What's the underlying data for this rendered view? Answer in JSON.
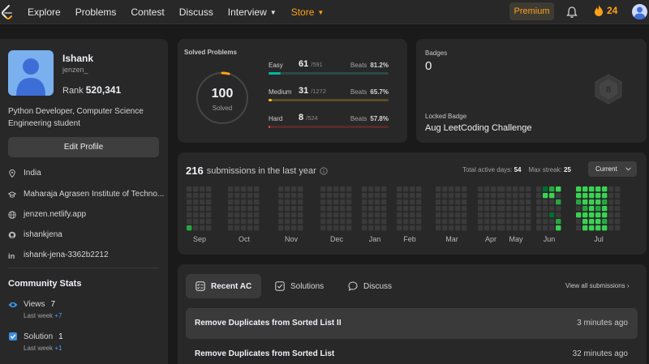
{
  "nav": {
    "items": [
      {
        "label": "Explore"
      },
      {
        "label": "Problems"
      },
      {
        "label": "Contest"
      },
      {
        "label": "Discuss"
      },
      {
        "label": "Interview"
      },
      {
        "label": "Store"
      }
    ],
    "premium_label": "Premium",
    "streak_count": "24",
    "colors": {
      "accent": "#ffa116",
      "bg": "#282828"
    }
  },
  "profile": {
    "name": "Ishank",
    "username": "jenzen_",
    "rank_label": "Rank",
    "rank_value": "520,341",
    "bio": "Python Developer, Computer Science Engineering student",
    "edit_label": "Edit Profile",
    "info": [
      {
        "icon": "location-icon",
        "text": "India"
      },
      {
        "icon": "graduation-cap-icon",
        "text": "Maharaja Agrasen Institute of Techno..."
      },
      {
        "icon": "globe-icon",
        "text": "jenzen.netlify.app"
      },
      {
        "icon": "github-icon",
        "text": "ishankjena"
      },
      {
        "icon": "linkedin-icon",
        "text": "ishank-jena-3362b2212"
      }
    ]
  },
  "community": {
    "title": "Community Stats",
    "views_label": "Views",
    "views_value": "7",
    "views_sub": "Last week",
    "views_delta": "+7",
    "solution_label": "Solution",
    "solution_value": "1",
    "solution_sub": "Last week",
    "solution_delta": "+1"
  },
  "solved": {
    "title": "Solved Problems",
    "total": "100",
    "total_label": "Solved",
    "ring_fraction": 0.042,
    "difficulties": [
      {
        "label": "Easy",
        "count": "61",
        "total": "/591",
        "beats_label": "Beats",
        "beats": "81.2%",
        "color": "#00b8a3",
        "fraction": 0.103
      },
      {
        "label": "Medium",
        "count": "31",
        "total": "/1272",
        "beats_label": "Beats",
        "beats": "65.7%",
        "color": "#ffc01e",
        "fraction": 0.024
      },
      {
        "label": "Hard",
        "count": "8",
        "total": "/524",
        "beats_label": "Beats",
        "beats": "57.8%",
        "color": "#ef4743",
        "fraction": 0.015
      }
    ]
  },
  "badges": {
    "label": "Badges",
    "count": "0",
    "locked_label": "Locked Badge",
    "locked_name": "Aug LeetCoding Challenge"
  },
  "heatmap": {
    "count": "216",
    "title_rest": "submissions in the last year",
    "active_label": "Total active days:",
    "active_value": "54",
    "streak_label": "Max streak:",
    "streak_value": "25",
    "select_value": "Current",
    "months": [
      "Sep",
      "Oct",
      "Nov",
      "Dec",
      "Jan",
      "Feb",
      "Mar",
      "Apr",
      "May",
      "Jun",
      "Jul"
    ],
    "levels": {
      "empty": "#3a3a3a",
      "l1": "#0e4429",
      "l2": "#006d32",
      "l3": "#26a641",
      "l4": "#39d353"
    }
  },
  "recent": {
    "tabs": [
      {
        "label": "Recent AC",
        "icon": "list-check-icon"
      },
      {
        "label": "Solutions",
        "icon": "checkbox-icon"
      },
      {
        "label": "Discuss",
        "icon": "chat-icon"
      }
    ],
    "view_all": "View all submissions",
    "rows": [
      {
        "title": "Remove Duplicates from Sorted List II",
        "time": "3 minutes ago"
      },
      {
        "title": "Remove Duplicates from Sorted List",
        "time": "32 minutes ago"
      }
    ]
  }
}
